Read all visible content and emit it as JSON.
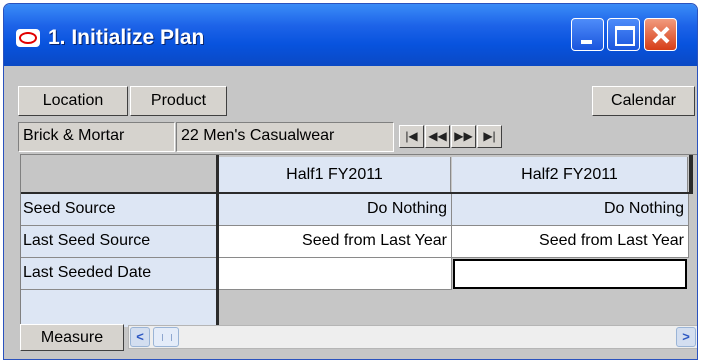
{
  "window": {
    "title": "1. Initialize Plan"
  },
  "toolbar": {
    "location": "Location",
    "product": "Product",
    "calendar": "Calendar"
  },
  "context": {
    "location_value": "Brick & Mortar",
    "product_value": "22 Men's Casualwear"
  },
  "nav": {
    "first": "|◀",
    "prev": "◀◀",
    "next": "▶▶",
    "last": "▶|"
  },
  "grid": {
    "columns": [
      "Half1 FY2011",
      "Half2 FY2011"
    ],
    "rows": [
      {
        "label": "Seed Source",
        "values": [
          "Do Nothing",
          "Do Nothing"
        ]
      },
      {
        "label": "Last Seed Source",
        "values": [
          "Seed from Last Year",
          "Seed from Last Year"
        ]
      },
      {
        "label": "Last Seeded Date",
        "values": [
          "",
          ""
        ]
      }
    ]
  },
  "statusbar": {
    "measure": "Measure",
    "scroll_left": "<",
    "scroll_right": ">"
  },
  "colors": {
    "titlebar": "#0853de",
    "close": "#d63d18",
    "header_bg": "#dde6f4"
  }
}
